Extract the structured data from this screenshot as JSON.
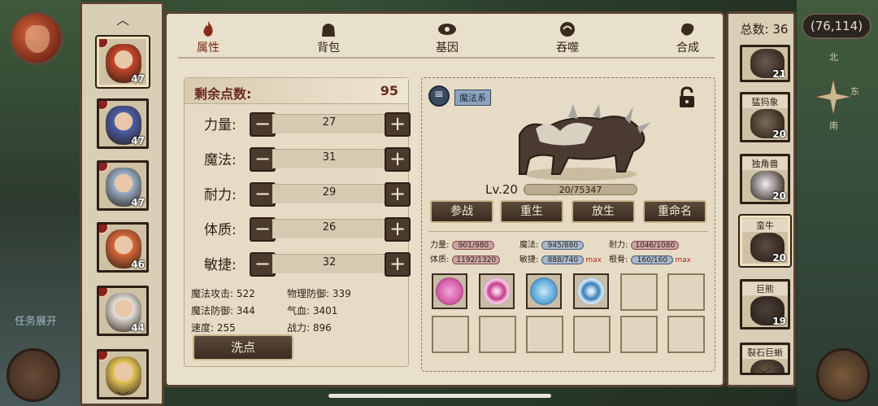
{
  "hud": {
    "coords": "(76,114)",
    "compass": {
      "north": "北",
      "east": "东",
      "south": "南"
    },
    "task_label": "任务展开"
  },
  "tabs": [
    {
      "label": "属性",
      "icon": "flame-icon",
      "active": true
    },
    {
      "label": "背包",
      "icon": "bag-icon",
      "active": false
    },
    {
      "label": "基因",
      "icon": "gene-icon",
      "active": false
    },
    {
      "label": "吞噬",
      "icon": "devour-icon",
      "active": false
    },
    {
      "label": "合成",
      "icon": "synthesis-icon",
      "active": false
    }
  ],
  "heroes": [
    {
      "level": "47",
      "color": "#c8452a",
      "selected": true
    },
    {
      "level": "47",
      "color": "#4a5ea8",
      "selected": false
    },
    {
      "level": "47",
      "color": "#9ab0c8",
      "selected": false
    },
    {
      "level": "46",
      "color": "#d8683a",
      "selected": false
    },
    {
      "level": "44",
      "color": "#e6e2dc",
      "selected": false
    },
    {
      "level": "",
      "color": "#e8c85a",
      "selected": false
    }
  ],
  "attributes": {
    "remaining_label": "剩余点数:",
    "remaining_value": "95",
    "stats": [
      {
        "name": "力量:",
        "value": "27"
      },
      {
        "name": "魔法:",
        "value": "31"
      },
      {
        "name": "耐力:",
        "value": "29"
      },
      {
        "name": "体质:",
        "value": "26"
      },
      {
        "name": "敏捷:",
        "value": "32"
      }
    ],
    "derived": {
      "magic_attack": "魔法攻击: 522",
      "physical_defense": "物理防御: 339",
      "magic_defense": "魔法防御: 344",
      "hp": "气血: 3401",
      "speed": "速度: 255",
      "power": "战力: 896"
    },
    "wash_button": "洗点"
  },
  "creature": {
    "school": "魔法系",
    "level_label": "Lv.20",
    "exp_text": "20/75347",
    "exp_fraction": 0.0003,
    "buttons": [
      "参战",
      "重生",
      "放生",
      "重命名"
    ],
    "stats": {
      "strength_label": "力量:",
      "strength_value": "901/980",
      "magic_label": "魔法:",
      "magic_value": "945/880",
      "stamina_label": "耐力:",
      "stamina_value": "1046/1080",
      "constitution_label": "体质:",
      "constitution_value": "1192/1320",
      "agility_label": "敏捷:",
      "agility_value": "888/740",
      "agility_max": "max",
      "root_label": "根骨:",
      "root_value": "160/160",
      "root_max": "max"
    },
    "skills": [
      {
        "icon": "pink-beast-skill-icon",
        "color": "#d65aa8"
      },
      {
        "icon": "pink-vortex-skill-icon",
        "color": "#c43a8a"
      },
      {
        "icon": "blue-beast-skill-icon",
        "color": "#5aa4d6"
      },
      {
        "icon": "blue-vortex-skill-icon",
        "color": "#3a7ab8"
      }
    ]
  },
  "right_panel": {
    "total": "总数: 36",
    "creatures": [
      {
        "name": "",
        "level": "21",
        "color": "#6a5a52",
        "selected": false
      },
      {
        "name": "猛犸象",
        "level": "20",
        "color": "#7a6a58",
        "selected": false
      },
      {
        "name": "独角兽",
        "level": "20",
        "color": "#f0ecf4",
        "selected": false
      },
      {
        "name": "蛮牛",
        "level": "20",
        "color": "#5a4a40",
        "selected": true
      },
      {
        "name": "巨熊",
        "level": "19",
        "color": "#4a403a",
        "selected": false
      },
      {
        "name": "裂石巨蜥",
        "level": "",
        "color": "#6a5a48",
        "selected": false
      }
    ]
  }
}
